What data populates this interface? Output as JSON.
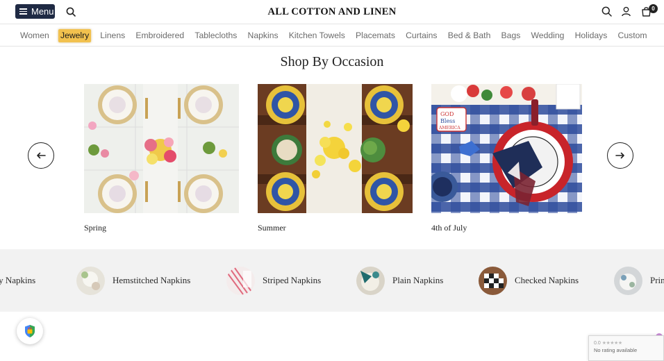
{
  "header": {
    "menu_label": "Menu",
    "brand": "ALL COTTON AND LINEN",
    "cart_count": "0"
  },
  "nav": {
    "items": [
      "Women",
      "Jewelry",
      "Linens",
      "Embroidered",
      "Tablecloths",
      "Napkins",
      "Kitchen Towels",
      "Placemats",
      "Curtains",
      "Bed & Bath",
      "Bags",
      "Wedding",
      "Holidays",
      "Custom"
    ],
    "active": "Jewelry"
  },
  "occasion": {
    "title": "Shop By Occasion",
    "cards": [
      {
        "caption": "Spring"
      },
      {
        "caption": "Summer"
      },
      {
        "caption": "4th of July"
      }
    ]
  },
  "napkin_categories": [
    {
      "label": "ery Napkins"
    },
    {
      "label": "Hemstitched Napkins"
    },
    {
      "label": "Striped Napkins"
    },
    {
      "label": "Plain Napkins"
    },
    {
      "label": "Checked Napkins"
    },
    {
      "label": "Prin"
    }
  ],
  "recaptcha": {
    "score": "0.0",
    "text": "No rating available"
  },
  "colors": {
    "menu_bg": "#1f2a44",
    "active_nav": "#f2c14e",
    "strip_bg": "#f2f2f2"
  }
}
